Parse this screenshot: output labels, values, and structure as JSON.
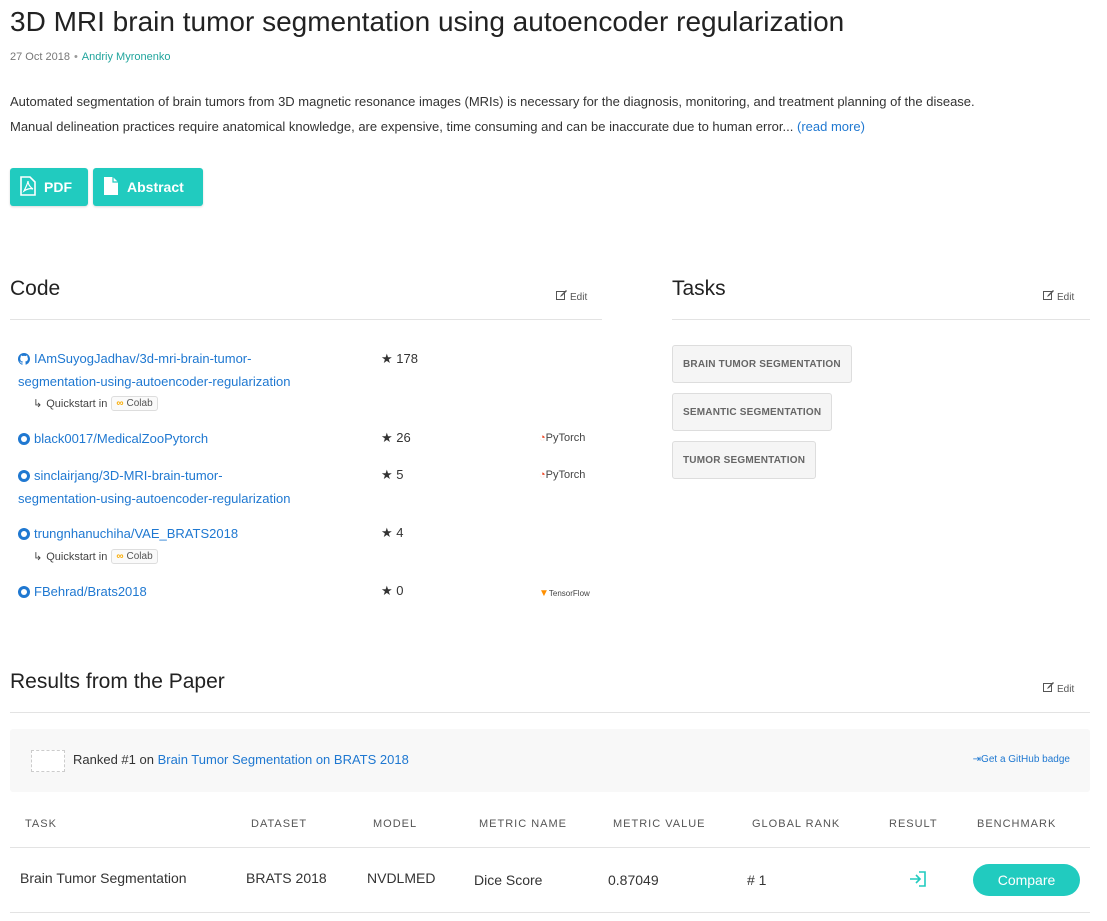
{
  "paper": {
    "title": "3D MRI brain tumor segmentation using autoencoder regularization",
    "date": "27 Oct 2018",
    "author": "Andriy Myronenko",
    "abstract_line1": "Automated segmentation of brain tumors from 3D magnetic resonance images (MRIs) is necessary for the diagnosis, monitoring, and treatment planning of the disease.",
    "abstract_line2": "Manual delineation practices require anatomical knowledge, are expensive, time consuming and can be inaccurate due to human error...",
    "read_more": "(read more)"
  },
  "buttons": {
    "pdf": "PDF",
    "abstract": "Abstract"
  },
  "code": {
    "heading": "Code",
    "edit": "Edit",
    "repos": [
      {
        "name_line1": "IAmSuyogJadhav/3d-mri-brain-tumor-",
        "name_line2": "segmentation-using-autoencoder-regularization",
        "stars": "178",
        "framework": "",
        "quickstart": true
      },
      {
        "name_line1": "black0017/MedicalZooPytorch",
        "name_line2": "",
        "stars": "26",
        "framework": "PyTorch",
        "quickstart": false
      },
      {
        "name_line1": "sinclairjang/3D-MRI-brain-tumor-",
        "name_line2": "segmentation-using-autoencoder-regularization",
        "stars": "5",
        "framework": "PyTorch",
        "quickstart": false
      },
      {
        "name_line1": "trungnhanuchiha/VAE_BRATS2018",
        "name_line2": "",
        "stars": "4",
        "framework": "",
        "quickstart": true
      },
      {
        "name_line1": "FBehrad/Brats2018",
        "name_line2": "",
        "stars": "0",
        "framework": "TensorFlow",
        "quickstart": false
      }
    ],
    "quickstart_label": "Quickstart in",
    "colab_label": "Colab"
  },
  "tasks": {
    "heading": "Tasks",
    "edit": "Edit",
    "items": [
      "BRAIN TUMOR SEGMENTATION",
      "SEMANTIC SEGMENTATION",
      "TUMOR SEGMENTATION"
    ]
  },
  "results": {
    "heading": "Results from the Paper",
    "edit": "Edit",
    "ranked_prefix": "Ranked #1 on",
    "ranked_link": "Brain Tumor Segmentation on BRATS 2018",
    "github_badge": "Get a GitHub badge",
    "columns": [
      "TASK",
      "DATASET",
      "MODEL",
      "METRIC NAME",
      "METRIC VALUE",
      "GLOBAL RANK",
      "RESULT",
      "BENCHMARK"
    ],
    "row": {
      "task": "Brain Tumor Segmentation",
      "dataset": "BRATS 2018",
      "model": "NVDLMED",
      "metric_name": "Dice Score",
      "metric_value": "0.87049",
      "global_rank": "# 1",
      "compare": "Compare"
    }
  },
  "colors": {
    "accent": "#21cbbf",
    "link": "#1f78d1",
    "author": "#21a59d"
  }
}
